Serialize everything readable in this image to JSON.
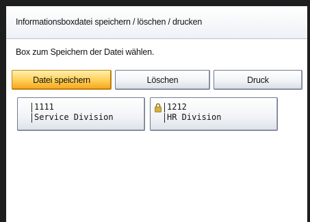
{
  "header": {
    "title": "Informationsboxdatei speichern / löschen / drucken"
  },
  "instruction": "Box zum Speichern der Datei wählen.",
  "tabs": [
    {
      "label": "Datei speichern",
      "active": true
    },
    {
      "label": "Löschen",
      "active": false
    },
    {
      "label": "Druck",
      "active": false
    }
  ],
  "boxes": [
    {
      "number": "1111",
      "name": "Service Division",
      "locked": false,
      "icon": "none"
    },
    {
      "number": "1212",
      "name": "HR Division",
      "locked": true,
      "icon": "lock-icon"
    }
  ],
  "colors": {
    "active_tab": "#f8b22e",
    "frame": "#1e1e1e",
    "button_border": "#6f7b8f",
    "lock_icon": "#c9a22a"
  }
}
